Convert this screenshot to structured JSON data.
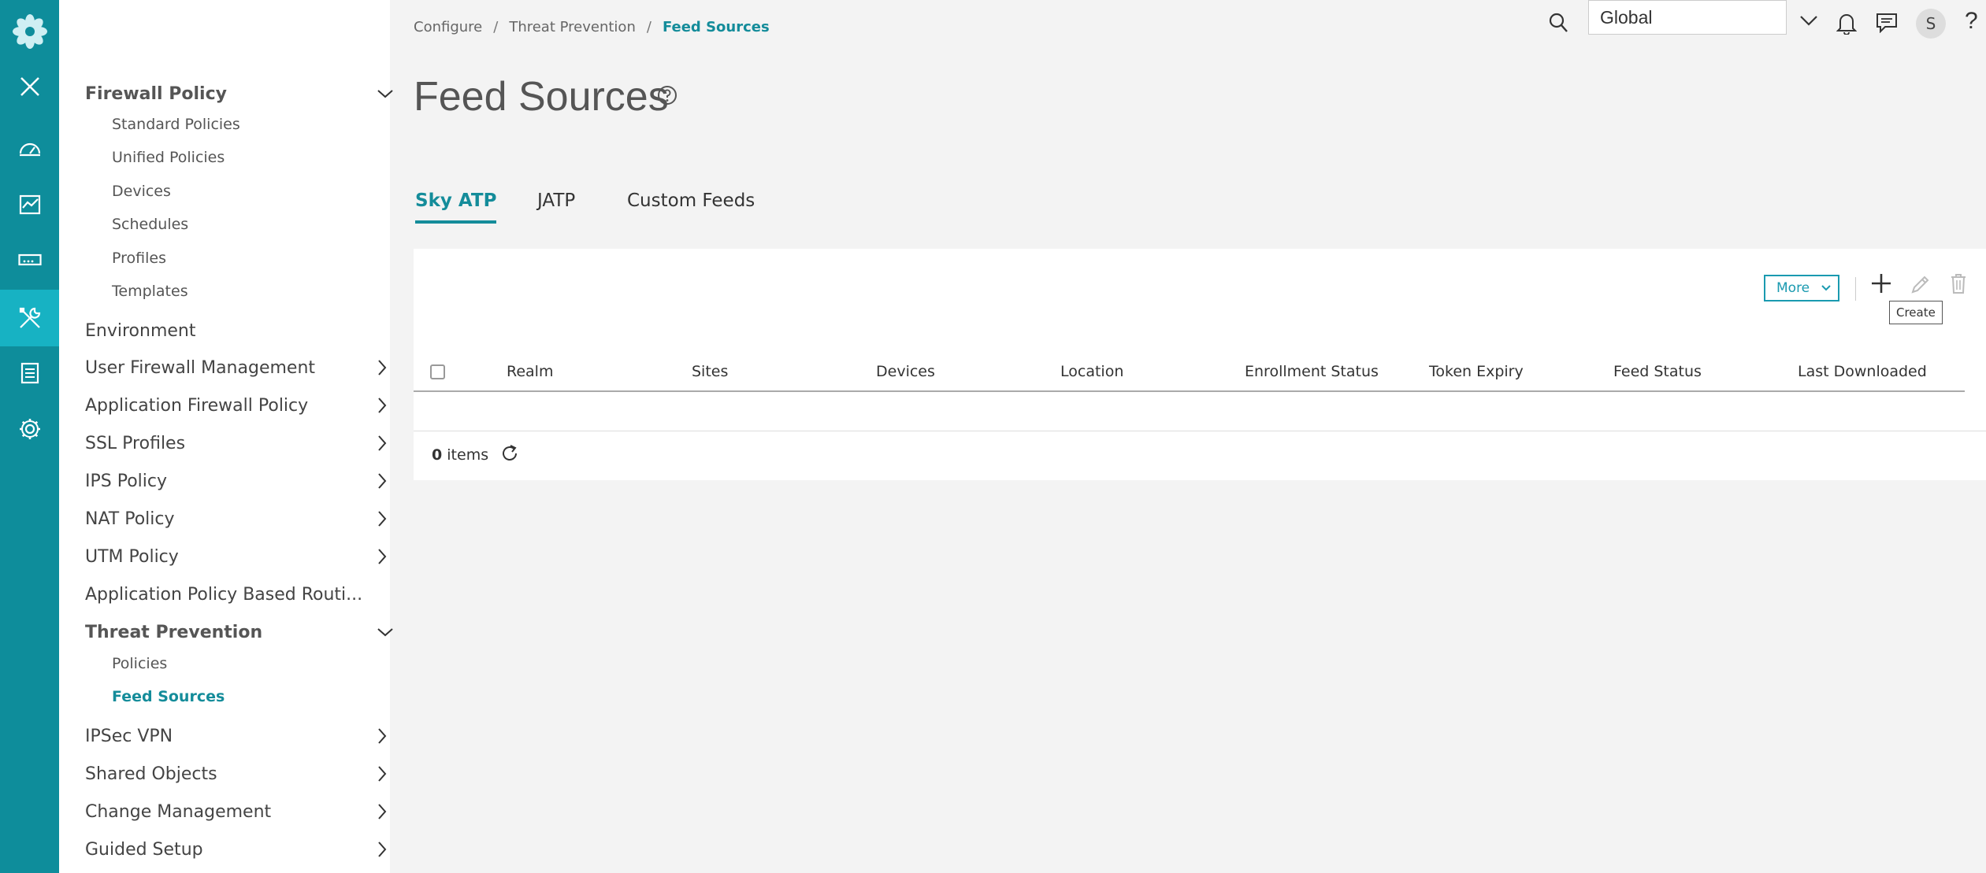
{
  "breadcrumb": [
    "Configure",
    "Threat Prevention",
    "Feed Sources"
  ],
  "topbar": {
    "domain_value": "Global",
    "avatar_initial": "S",
    "help_glyph": "?"
  },
  "page": {
    "title": "Feed Sources"
  },
  "tabs": [
    {
      "label": "Sky ATP",
      "active": true
    },
    {
      "label": "JATP",
      "active": false
    },
    {
      "label": "Custom Feeds",
      "active": false
    }
  ],
  "toolbar": {
    "more_label": "More",
    "create_tooltip": "Create"
  },
  "table": {
    "columns": [
      "Realm",
      "Sites",
      "Devices",
      "Location",
      "Enrollment Status",
      "Token Expiry",
      "Feed Status",
      "Last Downloaded"
    ],
    "rows": [],
    "count_value": "0",
    "count_suffix": "items"
  },
  "sidebar": {
    "firewall_policy": {
      "label": "Firewall Policy",
      "items": [
        "Standard Policies",
        "Unified Policies",
        "Devices",
        "Schedules",
        "Profiles",
        "Templates"
      ]
    },
    "environment": "Environment",
    "user_firewall": "User Firewall Management",
    "app_firewall": "Application Firewall Policy",
    "ssl_profiles": "SSL Profiles",
    "ips_policy": "IPS Policy",
    "nat_policy": "NAT Policy",
    "utm_policy": "UTM Policy",
    "app_routing": "Application Policy Based Routi...",
    "threat_prevention": {
      "label": "Threat Prevention",
      "items": [
        "Policies",
        "Feed Sources"
      ]
    },
    "ipsec_vpn": "IPSec VPN",
    "shared_objects": "Shared Objects",
    "change_mgmt": "Change Management",
    "guided_setup": "Guided Setup"
  },
  "colors": {
    "rail": "#0e8d9b",
    "rail_active": "#17b2c3",
    "accent": "#148c9a"
  },
  "icons": [
    "logo-icon",
    "close-icon",
    "dashboard-icon",
    "monitor-icon",
    "devices-icon",
    "configure-icon",
    "reports-icon",
    "settings-icon",
    "search-icon",
    "chevron-down-icon",
    "bell-icon",
    "message-icon",
    "help-icon",
    "plus-icon",
    "pencil-icon",
    "trash-icon",
    "refresh-icon",
    "chevron-right-icon"
  ]
}
